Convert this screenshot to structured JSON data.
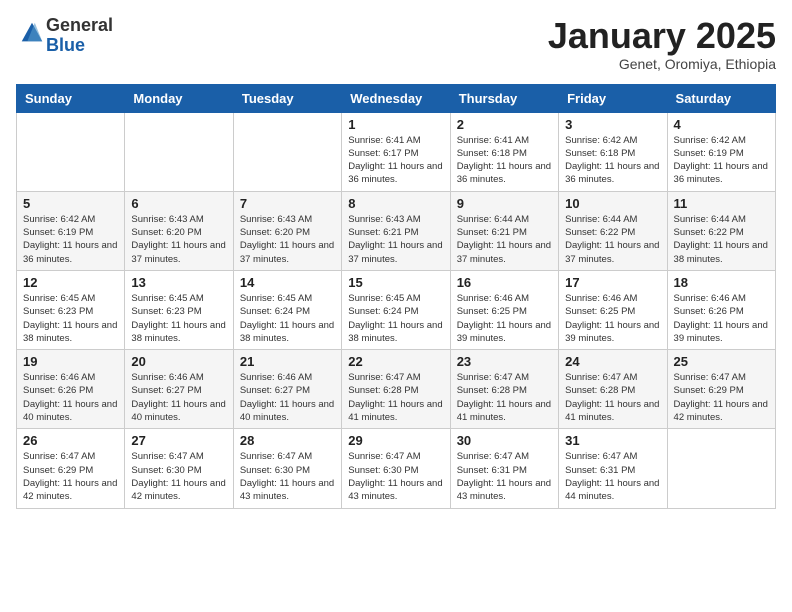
{
  "header": {
    "logo_general": "General",
    "logo_blue": "Blue",
    "month_title": "January 2025",
    "location": "Genet, Oromiya, Ethiopia"
  },
  "calendar": {
    "days_of_week": [
      "Sunday",
      "Monday",
      "Tuesday",
      "Wednesday",
      "Thursday",
      "Friday",
      "Saturday"
    ],
    "weeks": [
      [
        {
          "day": "",
          "info": ""
        },
        {
          "day": "",
          "info": ""
        },
        {
          "day": "",
          "info": ""
        },
        {
          "day": "1",
          "info": "Sunrise: 6:41 AM\nSunset: 6:17 PM\nDaylight: 11 hours and 36 minutes."
        },
        {
          "day": "2",
          "info": "Sunrise: 6:41 AM\nSunset: 6:18 PM\nDaylight: 11 hours and 36 minutes."
        },
        {
          "day": "3",
          "info": "Sunrise: 6:42 AM\nSunset: 6:18 PM\nDaylight: 11 hours and 36 minutes."
        },
        {
          "day": "4",
          "info": "Sunrise: 6:42 AM\nSunset: 6:19 PM\nDaylight: 11 hours and 36 minutes."
        }
      ],
      [
        {
          "day": "5",
          "info": "Sunrise: 6:42 AM\nSunset: 6:19 PM\nDaylight: 11 hours and 36 minutes."
        },
        {
          "day": "6",
          "info": "Sunrise: 6:43 AM\nSunset: 6:20 PM\nDaylight: 11 hours and 37 minutes."
        },
        {
          "day": "7",
          "info": "Sunrise: 6:43 AM\nSunset: 6:20 PM\nDaylight: 11 hours and 37 minutes."
        },
        {
          "day": "8",
          "info": "Sunrise: 6:43 AM\nSunset: 6:21 PM\nDaylight: 11 hours and 37 minutes."
        },
        {
          "day": "9",
          "info": "Sunrise: 6:44 AM\nSunset: 6:21 PM\nDaylight: 11 hours and 37 minutes."
        },
        {
          "day": "10",
          "info": "Sunrise: 6:44 AM\nSunset: 6:22 PM\nDaylight: 11 hours and 37 minutes."
        },
        {
          "day": "11",
          "info": "Sunrise: 6:44 AM\nSunset: 6:22 PM\nDaylight: 11 hours and 38 minutes."
        }
      ],
      [
        {
          "day": "12",
          "info": "Sunrise: 6:45 AM\nSunset: 6:23 PM\nDaylight: 11 hours and 38 minutes."
        },
        {
          "day": "13",
          "info": "Sunrise: 6:45 AM\nSunset: 6:23 PM\nDaylight: 11 hours and 38 minutes."
        },
        {
          "day": "14",
          "info": "Sunrise: 6:45 AM\nSunset: 6:24 PM\nDaylight: 11 hours and 38 minutes."
        },
        {
          "day": "15",
          "info": "Sunrise: 6:45 AM\nSunset: 6:24 PM\nDaylight: 11 hours and 38 minutes."
        },
        {
          "day": "16",
          "info": "Sunrise: 6:46 AM\nSunset: 6:25 PM\nDaylight: 11 hours and 39 minutes."
        },
        {
          "day": "17",
          "info": "Sunrise: 6:46 AM\nSunset: 6:25 PM\nDaylight: 11 hours and 39 minutes."
        },
        {
          "day": "18",
          "info": "Sunrise: 6:46 AM\nSunset: 6:26 PM\nDaylight: 11 hours and 39 minutes."
        }
      ],
      [
        {
          "day": "19",
          "info": "Sunrise: 6:46 AM\nSunset: 6:26 PM\nDaylight: 11 hours and 40 minutes."
        },
        {
          "day": "20",
          "info": "Sunrise: 6:46 AM\nSunset: 6:27 PM\nDaylight: 11 hours and 40 minutes."
        },
        {
          "day": "21",
          "info": "Sunrise: 6:46 AM\nSunset: 6:27 PM\nDaylight: 11 hours and 40 minutes."
        },
        {
          "day": "22",
          "info": "Sunrise: 6:47 AM\nSunset: 6:28 PM\nDaylight: 11 hours and 41 minutes."
        },
        {
          "day": "23",
          "info": "Sunrise: 6:47 AM\nSunset: 6:28 PM\nDaylight: 11 hours and 41 minutes."
        },
        {
          "day": "24",
          "info": "Sunrise: 6:47 AM\nSunset: 6:28 PM\nDaylight: 11 hours and 41 minutes."
        },
        {
          "day": "25",
          "info": "Sunrise: 6:47 AM\nSunset: 6:29 PM\nDaylight: 11 hours and 42 minutes."
        }
      ],
      [
        {
          "day": "26",
          "info": "Sunrise: 6:47 AM\nSunset: 6:29 PM\nDaylight: 11 hours and 42 minutes."
        },
        {
          "day": "27",
          "info": "Sunrise: 6:47 AM\nSunset: 6:30 PM\nDaylight: 11 hours and 42 minutes."
        },
        {
          "day": "28",
          "info": "Sunrise: 6:47 AM\nSunset: 6:30 PM\nDaylight: 11 hours and 43 minutes."
        },
        {
          "day": "29",
          "info": "Sunrise: 6:47 AM\nSunset: 6:30 PM\nDaylight: 11 hours and 43 minutes."
        },
        {
          "day": "30",
          "info": "Sunrise: 6:47 AM\nSunset: 6:31 PM\nDaylight: 11 hours and 43 minutes."
        },
        {
          "day": "31",
          "info": "Sunrise: 6:47 AM\nSunset: 6:31 PM\nDaylight: 11 hours and 44 minutes."
        },
        {
          "day": "",
          "info": ""
        }
      ]
    ]
  }
}
